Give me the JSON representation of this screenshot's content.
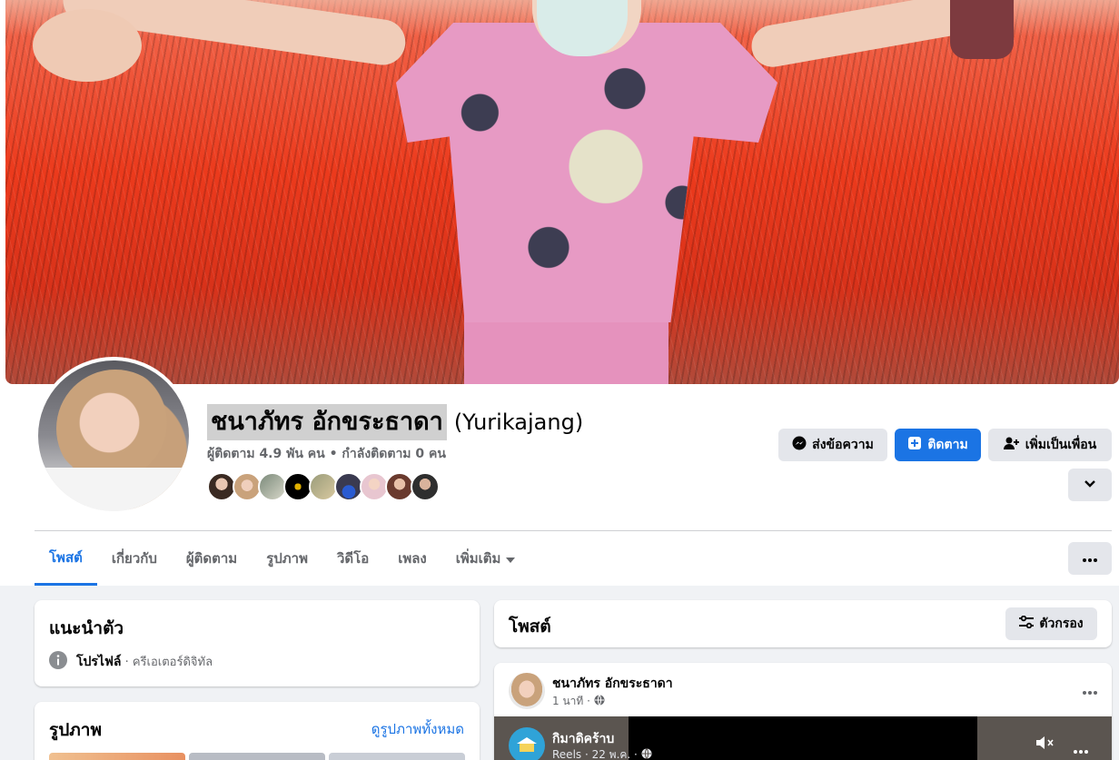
{
  "profile": {
    "name": "ชนาภัทร อักขระธาดา",
    "alt_name": "(Yurikajang)",
    "stats": "ผู้ติดตาม 4.9 พัน คน • กำลังติดตาม 0 คน"
  },
  "actions": {
    "message_label": "ส่งข้อความ",
    "follow_label": "ติดตาม",
    "add_friend_label": "เพิ่มเป็นเพื่อน"
  },
  "tabs": [
    {
      "label": "โพสต์",
      "active": true
    },
    {
      "label": "เกี่ยวกับ"
    },
    {
      "label": "ผู้ติดตาม"
    },
    {
      "label": "รูปภาพ"
    },
    {
      "label": "วิดีโอ"
    },
    {
      "label": "เพลง"
    },
    {
      "label": "เพิ่มเติม"
    }
  ],
  "intro": {
    "title": "แนะนำตัว",
    "profile_label": "โปรไฟล์",
    "profile_desc": " · ครีเอเตอร์ดิจิทัล"
  },
  "photos": {
    "title": "รูปภาพ",
    "see_all": "ดูรูปภาพทั้งหมด"
  },
  "posts": {
    "title": "โพสต์",
    "filter_label": "ตัวกรอง"
  },
  "post": {
    "author": "ชนาภัทร อักขระธาดา",
    "time": "1 นาที ·",
    "shared_page": "กิมาดิคร้าบ",
    "shared_meta": "Reels · 22 พ.ค. ·"
  },
  "colors": {
    "accent": "#1b74e4",
    "page_bg": "#f0f2f5",
    "button_grey": "#e4e6eb"
  },
  "icons": [
    "messenger-icon",
    "follow-icon",
    "add-friend-icon",
    "chevron-down-icon",
    "more-icon",
    "info-icon",
    "filter-icon",
    "globe-icon",
    "mute-icon"
  ]
}
